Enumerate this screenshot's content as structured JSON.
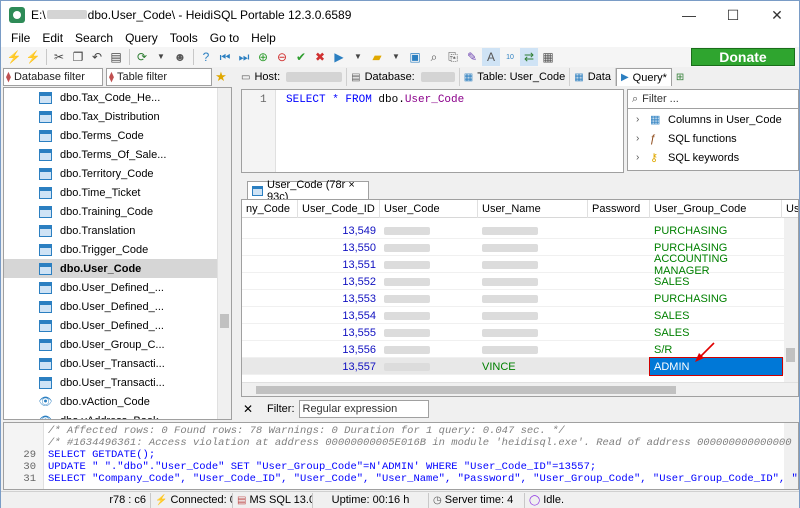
{
  "window": {
    "title_prefix": "E:\\",
    "title_suffix": "dbo.User_Code\\ - HeidiSQL Portable 12.3.0.6589",
    "minimize": "—",
    "maximize": "☐",
    "close": "✕"
  },
  "menu": [
    "File",
    "Edit",
    "Search",
    "Query",
    "Tools",
    "Go to",
    "Help"
  ],
  "toolbar": {
    "donate_label": "Donate"
  },
  "left": {
    "db_filter_placeholder": "Database filter",
    "table_filter_placeholder": "Table filter",
    "tree": [
      {
        "label": "dbo.Tax_Code_He...",
        "type": "table",
        "selected": false
      },
      {
        "label": "dbo.Tax_Distribution",
        "type": "table",
        "selected": false
      },
      {
        "label": "dbo.Terms_Code",
        "type": "table",
        "selected": false
      },
      {
        "label": "dbo.Terms_Of_Sale...",
        "type": "table",
        "selected": false
      },
      {
        "label": "dbo.Territory_Code",
        "type": "table",
        "selected": false
      },
      {
        "label": "dbo.Time_Ticket",
        "type": "table",
        "selected": false
      },
      {
        "label": "dbo.Training_Code",
        "type": "table",
        "selected": false
      },
      {
        "label": "dbo.Translation",
        "type": "table",
        "selected": false
      },
      {
        "label": "dbo.Trigger_Code",
        "type": "table",
        "selected": false
      },
      {
        "label": "dbo.User_Code",
        "type": "table",
        "selected": true
      },
      {
        "label": "dbo.User_Defined_...",
        "type": "table",
        "selected": false
      },
      {
        "label": "dbo.User_Defined_...",
        "type": "table",
        "selected": false
      },
      {
        "label": "dbo.User_Defined_...",
        "type": "table",
        "selected": false
      },
      {
        "label": "dbo.User_Group_C...",
        "type": "table",
        "selected": false
      },
      {
        "label": "dbo.User_Transacti...",
        "type": "table",
        "selected": false
      },
      {
        "label": "dbo.User_Transacti...",
        "type": "table",
        "selected": false
      },
      {
        "label": "dbo.vAction_Code",
        "type": "view",
        "selected": false
      },
      {
        "label": "dbo.vAddress_Book",
        "type": "view",
        "selected": false
      }
    ]
  },
  "tabs": {
    "host": "Host:",
    "database": "Database:",
    "table": "Table: User_Code",
    "data": "Data",
    "query": "Query*"
  },
  "editor": {
    "line_no": "1",
    "select": "SELECT",
    "star_from": " * FROM ",
    "schema": "dbo.",
    "table": "User_Code"
  },
  "objects": {
    "filter_placeholder": "Filter ...",
    "items": [
      "Columns in User_Code",
      "SQL functions",
      "SQL keywords"
    ]
  },
  "result": {
    "tab_label": "User_Code (78r × 93c)",
    "columns": [
      "ny_Code",
      "User_Code_ID",
      "User_Code",
      "User_Name",
      "Password",
      "User_Group_Code",
      "Us"
    ],
    "rows": [
      {
        "id": "13,549",
        "user_name": "",
        "group": "PURCHASING"
      },
      {
        "id": "13,550",
        "user_name": "",
        "group": "PURCHASING"
      },
      {
        "id": "13,551",
        "user_name": "",
        "group": "ACCOUNTING MANAGER"
      },
      {
        "id": "13,552",
        "user_name": "",
        "group": "SALES"
      },
      {
        "id": "13,553",
        "user_name": "",
        "group": "PURCHASING"
      },
      {
        "id": "13,554",
        "user_name": "",
        "group": "SALES"
      },
      {
        "id": "13,555",
        "user_name": "",
        "group": "SALES"
      },
      {
        "id": "13,556",
        "user_name": "",
        "group": "S/R"
      },
      {
        "id": "13,557",
        "user_name": "VINCE",
        "group": "ADMIN"
      }
    ],
    "filter_label": "Filter:",
    "filter_placeholder": "Regular expression"
  },
  "log": {
    "lines": [
      {
        "no": "",
        "text": "/* Affected rows: 0  Found rows: 78  Warnings: 0  Duration for 1 query: 0.047 sec. */",
        "kind": "comment"
      },
      {
        "no": "",
        "text": "/* #1634496361: Access violation at address 00000000005E016B in module 'heidisql.exe'. Read of address 000000000000000 Mes",
        "kind": "comment"
      },
      {
        "no": "29",
        "text": "SELECT GETDATE();",
        "kind": "sql"
      },
      {
        "no": "30",
        "text": "UPDATE \"         \".\"dbo\".\"User_Code\" SET \"User_Group_Code\"=N'ADMIN' WHERE  \"User_Code_ID\"=13557;",
        "kind": "sql"
      },
      {
        "no": "31",
        "text": "SELECT \"Company_Code\", \"User_Code_ID\", \"User_Code\", \"User_Name\", \"Password\", \"User_Group_Code\", \"User_Group_Code_ID\", \"EMai",
        "kind": "sql"
      }
    ]
  },
  "status": {
    "position": "r78 : c6",
    "connected": "Connected: 0(",
    "server": "MS SQL 13.0",
    "uptime": "Uptime: 00:16 h",
    "server_time": "Server time: 4",
    "state": "Idle."
  }
}
